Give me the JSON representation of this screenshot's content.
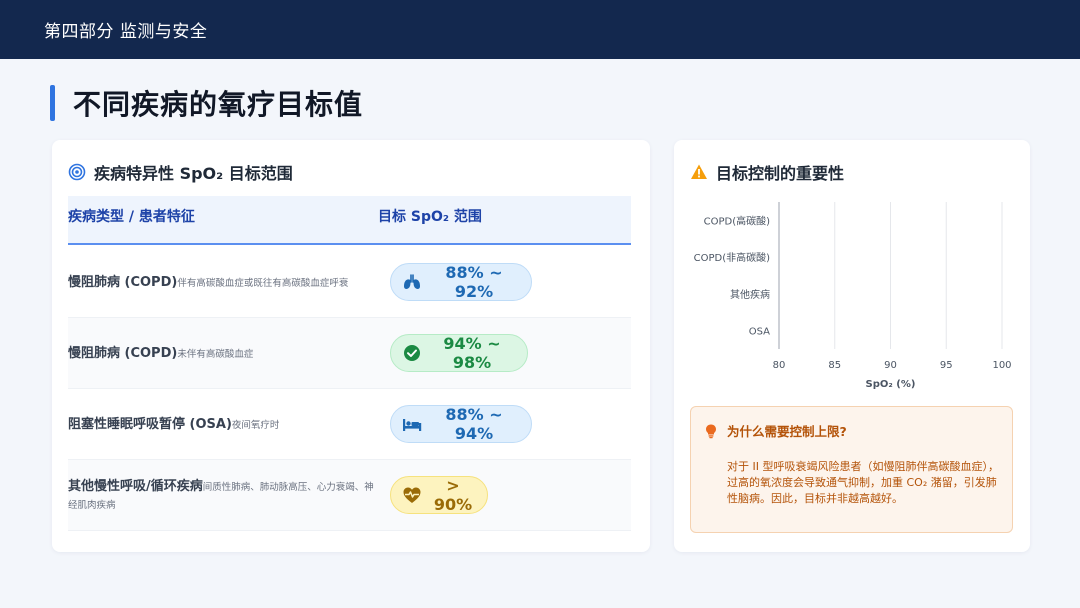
{
  "header": {
    "section": "第四部分 监测与安全"
  },
  "page_title": "不同疾病的氧疗目标值",
  "left_card": {
    "title": "疾病特异性 SpO₂ 目标范围",
    "columns": [
      "疾病类型 / 患者特征",
      "目标 SpO₂ 范围"
    ],
    "rows": [
      {
        "main": "慢阻肺病 (COPD)",
        "sub": "伴有高碳酸血症或既往有高碳酸血症呼衰",
        "range_line1": "88% ~",
        "range_line2": "92%",
        "icon": "lungs-icon",
        "color": "#1e69b3"
      },
      {
        "main": "慢阻肺病 (COPD)",
        "sub": "未伴有高碳酸血症",
        "range_line1": "94% ~",
        "range_line2": "98%",
        "icon": "check-circle-icon",
        "color": "#1b8a43"
      },
      {
        "main": "阻塞性睡眠呼吸暂停 (OSA)",
        "sub": "夜间氧疗时",
        "range_line1": "88% ~",
        "range_line2": "94%",
        "icon": "bed-icon",
        "color": "#1e69b3"
      },
      {
        "main": "其他慢性呼吸/循环疾病",
        "sub": "间质性肺病、肺动脉高压、心力衰竭、神经肌肉疾病",
        "range_line1": ">",
        "range_line2": "90%",
        "icon": "heart-pulse-icon",
        "color": "#9a6b07"
      }
    ]
  },
  "right_card": {
    "title": "目标控制的重要性",
    "note_title": "为什么需要控制上限?",
    "note_body": "对于 II 型呼吸衰竭风险患者（如慢阻肺伴高碳酸血症），过高的氧浓度会导致通气抑制，加重 CO₂ 潴留，引发肺性脑病。因此，目标并非越高越好。"
  },
  "chart_data": {
    "type": "bar",
    "orientation": "horizontal",
    "categories": [
      "COPD(高碳酸)",
      "COPD(非高碳酸)",
      "其他疾病",
      "OSA"
    ],
    "series": [],
    "xlabel": "SpO₂ (%)",
    "xlim": [
      80,
      100
    ],
    "xticks": [
      80,
      85,
      90,
      95,
      100
    ],
    "grid": true
  },
  "colors": {
    "topbar": "#13284e",
    "accent": "#2f74e0",
    "header_text": "#1e43a8"
  }
}
